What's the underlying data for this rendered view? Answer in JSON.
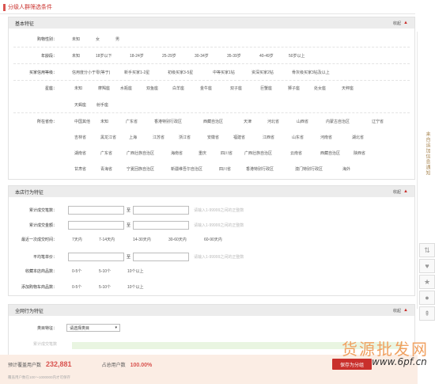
{
  "page_title": "分级人群筛选条件",
  "basic": {
    "title": "基本特征",
    "toggle": "收起",
    "gender": {
      "label": "购物性别：",
      "options": [
        "未知",
        "女",
        "男"
      ]
    },
    "age": {
      "label": "年龄段：",
      "options": [
        "未知",
        "18岁以下",
        "18-24岁",
        "25-29岁",
        "30-34岁",
        "35-39岁",
        "40-49岁",
        "50岁以上"
      ]
    },
    "level": {
      "label": "买家信用等级：",
      "options": [
        "信用度分小于零(等于)",
        "新手买家1-2星",
        "初级买家3-5星",
        "中等买家1钻",
        "资深买家2钻",
        "骨灰级买家3钻及以上"
      ]
    },
    "zodiac": {
      "label": "星座：",
      "row1": [
        "未知",
        "摩羯座",
        "水瓶座",
        "双鱼座",
        "白羊座",
        "金牛座",
        "双子座",
        "巨蟹座",
        "狮子座",
        "处女座",
        "天秤座"
      ],
      "row2": [
        "天蝎座",
        "射手座"
      ]
    },
    "province": {
      "label": "所在省份：",
      "row1": [
        "中国其他",
        "未知",
        "广东省",
        "香港特别行政区",
        "西藏自治区",
        "天津",
        "河北省",
        "山西省",
        "内蒙古自治区",
        "辽宁省"
      ],
      "row2": [
        "吉林省",
        "黑龙江省",
        "上海",
        "江苏省",
        "浙江省",
        "安徽省",
        "福建省",
        "江西省",
        "山东省",
        "河南省",
        "湖北省"
      ],
      "row3": [
        "湖南省",
        "广东省",
        "广西壮族自治区",
        "海南省",
        "重庆",
        "四川省",
        "广西壮族自治区",
        "云南省",
        "西藏自治区",
        "陕西省"
      ],
      "row4": [
        "甘肃省",
        "青海省",
        "宁夏回族自治区",
        "新疆维吾尔自治区",
        "四川省",
        "香港特别行政区",
        "澳门特别行政区",
        "海外"
      ]
    }
  },
  "store": {
    "title": "本店行为特征",
    "toggle": "收起",
    "count": {
      "label": "累计成交笔数：",
      "to": "至",
      "hint": "请输入1-99999之间的正整数"
    },
    "amount": {
      "label": "累计成交金额：",
      "to": "至",
      "hint": "请输入1-99999之间的正整数"
    },
    "last": {
      "label": "最近一次成交时间：",
      "options": [
        "7天内",
        "7-14天内",
        "14-30天内",
        "30-60天内",
        "60-90天内"
      ]
    },
    "avg": {
      "label": "平均笔单价：",
      "to": "至",
      "hint": "请输入1-99999之间的正整数"
    },
    "fav": {
      "label": "收藏本店商品数：",
      "options": [
        "0-5个",
        "5-10个",
        "10个以上"
      ]
    },
    "cart": {
      "label": "添加购物车商品数：",
      "options": [
        "0-5个",
        "5-10个",
        "10个以上"
      ]
    }
  },
  "network": {
    "title": "全网行为特征",
    "toggle": "收起",
    "category": {
      "label": "类目特征：",
      "placeholder": "请选择类目"
    },
    "faded_label": "累计成交笔数"
  },
  "footer": {
    "est_label": "预计覆盖用户数",
    "est_value": "232,881",
    "ratio_label": "占总用户数",
    "ratio_value": "100.00%",
    "note": "覆盖用户数在100～1000000内才可保存",
    "save": "保存为分组"
  },
  "side_text": "来自追加信息通知",
  "watermark": {
    "cn": "货源批发网",
    "url": "www.6pf.cn"
  },
  "colors": {
    "accent": "#c9302c",
    "header_bg": "#ececec",
    "footer_bg": "#fbede4"
  }
}
